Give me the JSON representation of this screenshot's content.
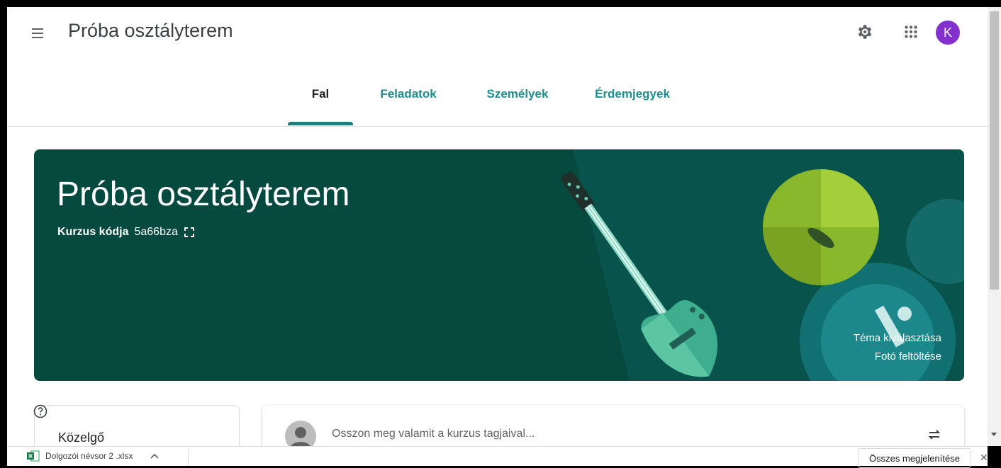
{
  "header": {
    "title": "Próba osztályterem",
    "avatar_letter": "K",
    "avatar_color": "#8430ce"
  },
  "tabs": [
    {
      "label": "Fal",
      "active": true
    },
    {
      "label": "Feladatok",
      "active": false
    },
    {
      "label": "Személyek",
      "active": false
    },
    {
      "label": "Érdemjegyek",
      "active": false
    }
  ],
  "banner": {
    "title": "Próba osztályterem",
    "code_label": "Kurzus kódja",
    "code_value": "5a66bza",
    "select_theme": "Téma kiválasztása",
    "upload_photo": "Fotó feltöltése",
    "background_color": "#06493f"
  },
  "upcoming": {
    "title": "Közelgő"
  },
  "share": {
    "placeholder": "Osszon meg valamit a kurzus tagjaival..."
  },
  "download_bar": {
    "file_name": "Dolgozói névsor 2 .xlsx",
    "show_all": "Összes megjelenítése"
  },
  "accent_color": "#1e8e8e"
}
